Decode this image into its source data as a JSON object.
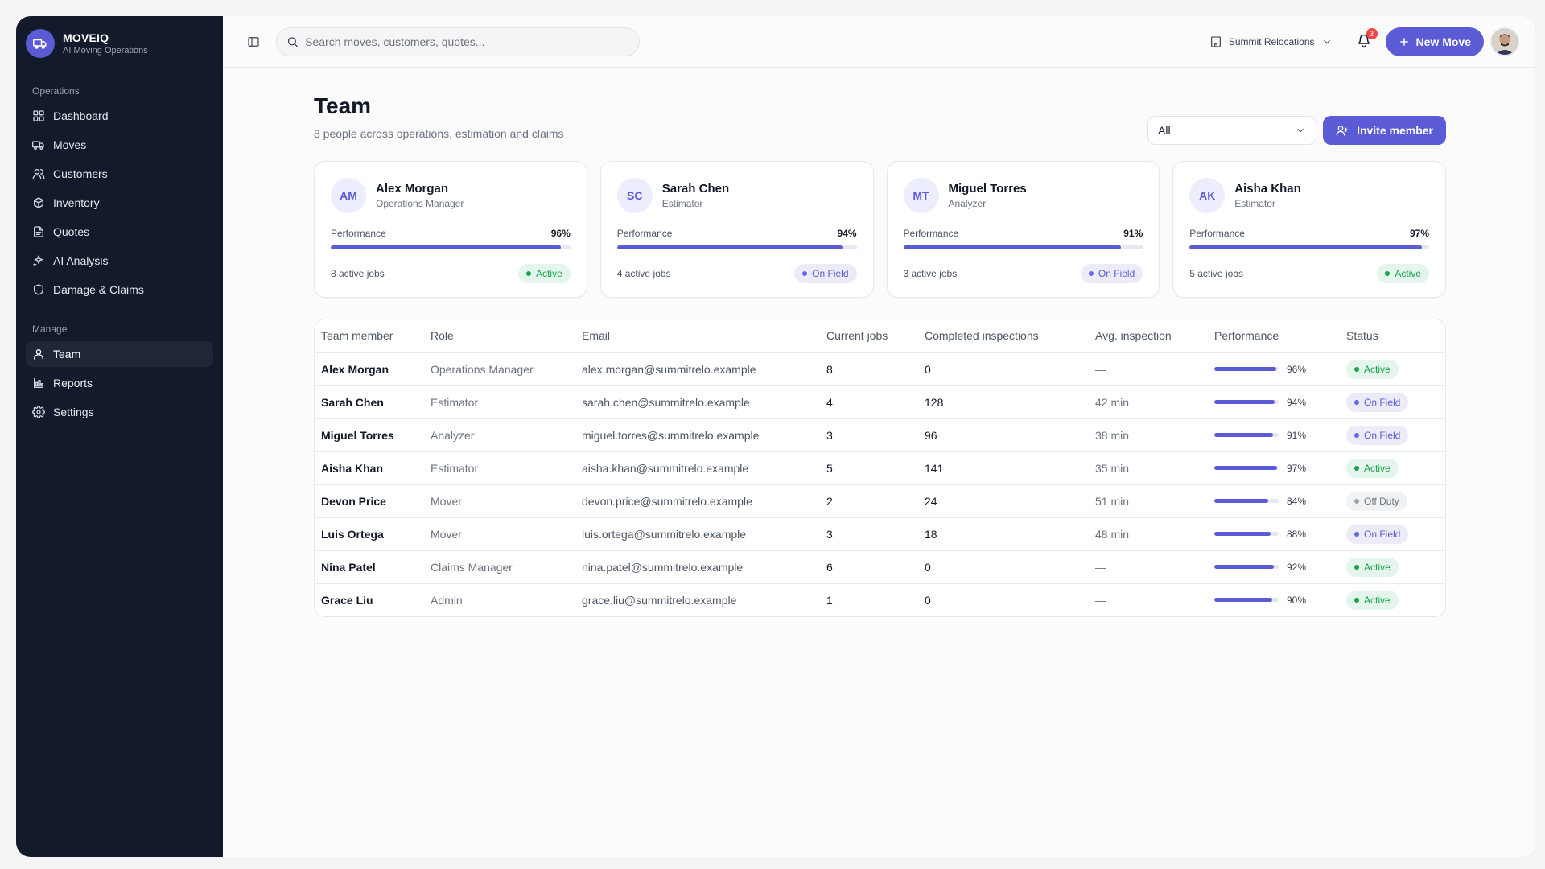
{
  "brand": {
    "name": "MOVEIQ",
    "tagline": "AI Moving Operations"
  },
  "sidebar": {
    "section_ops": "Operations",
    "ops_items": [
      {
        "label": "Dashboard",
        "icon": "dashboard-icon"
      },
      {
        "label": "Moves",
        "icon": "truck-icon"
      },
      {
        "label": "Customers",
        "icon": "users-icon"
      },
      {
        "label": "Inventory",
        "icon": "boxes-icon"
      },
      {
        "label": "Quotes",
        "icon": "file-icon"
      },
      {
        "label": "AI Analysis",
        "icon": "sparkles-icon"
      },
      {
        "label": "Damage & Claims",
        "icon": "shield-icon"
      }
    ],
    "section_manage": "Manage",
    "manage_items": [
      {
        "label": "Team",
        "icon": "user-icon",
        "active": true
      },
      {
        "label": "Reports",
        "icon": "bar-chart-icon"
      },
      {
        "label": "Settings",
        "icon": "gear-icon"
      }
    ]
  },
  "topbar": {
    "search_placeholder": "Search moves, customers, quotes...",
    "org_name": "Summit Relocations",
    "notification_count": "3",
    "new_move_label": "New Move"
  },
  "page": {
    "title": "Team",
    "subtitle": "8 people across operations, estimation and claims",
    "filter_value": "All",
    "invite_label": "Invite member"
  },
  "cards": [
    {
      "initials": "AM",
      "name": "Alex Morgan",
      "role": "Operations Manager",
      "perf_label": "Performance",
      "perf": "96%",
      "perf_value": 96,
      "jobs": "8 active jobs",
      "status": "Active",
      "status_kind": "active"
    },
    {
      "initials": "SC",
      "name": "Sarah Chen",
      "role": "Estimator",
      "perf_label": "Performance",
      "perf": "94%",
      "perf_value": 94,
      "jobs": "4 active jobs",
      "status": "On Field",
      "status_kind": "onfield"
    },
    {
      "initials": "MT",
      "name": "Miguel Torres",
      "role": "Analyzer",
      "perf_label": "Performance",
      "perf": "91%",
      "perf_value": 91,
      "jobs": "3 active jobs",
      "status": "On Field",
      "status_kind": "onfield"
    },
    {
      "initials": "AK",
      "name": "Aisha Khan",
      "role": "Estimator",
      "perf_label": "Performance",
      "perf": "97%",
      "perf_value": 97,
      "jobs": "5 active jobs",
      "status": "Active",
      "status_kind": "active"
    }
  ],
  "table": {
    "headers": [
      "Team member",
      "Role",
      "Email",
      "Current jobs",
      "Completed inspections",
      "Avg. inspection",
      "Performance",
      "Status"
    ],
    "rows": [
      {
        "name": "Alex Morgan",
        "role": "Operations Manager",
        "email": "alex.morgan@summitrelo.example",
        "jobs": "8",
        "completed": "0",
        "avg": "—",
        "perf": "96%",
        "perf_value": 96,
        "status": "Active",
        "status_kind": "active"
      },
      {
        "name": "Sarah Chen",
        "role": "Estimator",
        "email": "sarah.chen@summitrelo.example",
        "jobs": "4",
        "completed": "128",
        "avg": "42 min",
        "perf": "94%",
        "perf_value": 94,
        "status": "On Field",
        "status_kind": "onfield"
      },
      {
        "name": "Miguel Torres",
        "role": "Analyzer",
        "email": "miguel.torres@summitrelo.example",
        "jobs": "3",
        "completed": "96",
        "avg": "38 min",
        "perf": "91%",
        "perf_value": 91,
        "status": "On Field",
        "status_kind": "onfield"
      },
      {
        "name": "Aisha Khan",
        "role": "Estimator",
        "email": "aisha.khan@summitrelo.example",
        "jobs": "5",
        "completed": "141",
        "avg": "35 min",
        "perf": "97%",
        "perf_value": 97,
        "status": "Active",
        "status_kind": "active"
      },
      {
        "name": "Devon Price",
        "role": "Mover",
        "email": "devon.price@summitrelo.example",
        "jobs": "2",
        "completed": "24",
        "avg": "51 min",
        "perf": "84%",
        "perf_value": 84,
        "status": "Off Duty",
        "status_kind": "offduty"
      },
      {
        "name": "Luis Ortega",
        "role": "Mover",
        "email": "luis.ortega@summitrelo.example",
        "jobs": "3",
        "completed": "18",
        "avg": "48 min",
        "perf": "88%",
        "perf_value": 88,
        "status": "On Field",
        "status_kind": "onfield"
      },
      {
        "name": "Nina Patel",
        "role": "Claims Manager",
        "email": "nina.patel@summitrelo.example",
        "jobs": "6",
        "completed": "0",
        "avg": "—",
        "perf": "92%",
        "perf_value": 92,
        "status": "Active",
        "status_kind": "active"
      },
      {
        "name": "Grace Liu",
        "role": "Admin",
        "email": "grace.liu@summitrelo.example",
        "jobs": "1",
        "completed": "0",
        "avg": "—",
        "perf": "90%",
        "perf_value": 90,
        "status": "Active",
        "status_kind": "active"
      }
    ]
  },
  "colors": {
    "accent": "#5b5bd6",
    "sidebar_bg": "#131a2b",
    "active_green": "#16a34a",
    "badge_red": "#ef4444"
  }
}
